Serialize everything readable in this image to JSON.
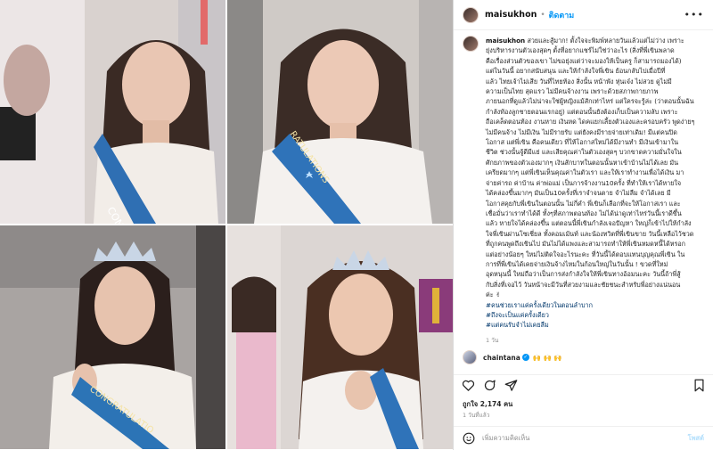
{
  "header": {
    "username": "maisukhon",
    "separator": "•",
    "follow_label": "ติดตาม",
    "more_icon": "more-horizontal-icon"
  },
  "caption": {
    "username": "maisukhon",
    "lines": [
      "สวยและสู้มาก! ตั้งใจจะพิมพ์หลายวันแล้วแต่ไม่ว่าง เพราะ",
      "ยุ่งบริหารงานตัวเองสุดๆ ตั้งที่อยากแชร์ไม่ใช่ว่าอะไร (สิ่งที่พี่เขินพลาด",
      "คือเรื่องส่วนตัวของเขา ไม่ขอยุ่งแต่ว่าจะมองให้เป็นครู ก็สามารถมองได้)",
      "แต่ในวันนี้ อยากสนับสนุน และให้กำลังใจพี่เขิน ย้อนกลับไปเมื่อปีที่",
      "แล้ว ไทยเจ้าไม่เสีย วันที่ไทยท้อง สิ่งนั้น หน้าพัง หุ่นเจ๋ง ไม่สวย ดูไม่มี",
      "ความเป็นไทย สุดแรว ไม่มีคนจ้างงาน เพราะด้วยสภาพกายภาพ",
      "ภายนอกที่ดูแล้วไม่น่าจะใช่ผู้หญิงแม้สักเท่าไหร่ แต่ใครจะรู้ล่ะ (ว่าตอนนั้นฉัน",
      "กำลังท้องลูกชายตอนแรกอยู่) แต่ตอนนั้นยังต้องเก็บเป็นความลับ เพราะ",
      "ถือเคล็ดตอนท้อง งานหาย เงินหด ไดคแยกเลี้ยงตัวเองและครอบครัว พูดง่ายๆ",
      "ไม่มีคนจ้าง ไม่มีเงิน ไม่มีรายรับ แต่ยังคงมีรายจ่ายเท่าเดิม! มีแต่คนปิด",
      "โอกาส แต่พี่เขิน คือคนเดียว ที่ให้โอกาสใหม่ได้มีงานทำ มีเงินเข้ามาใน",
      "ชีวิต ช่วงนั้นจู้ดีมีแย่ และเสียคุณค่าในตัวเองสุดๆ บวกขาดความมั่นใจใน",
      "ศักยภาพของตัวเองมากๆ เงินสักบาทในตอนนั้นหาเข้าบ้านไม่ได้เลย มัน",
      "เครียดมากๆ แต่พี่เขินเห็นคุณค่าในตัวเรา และให้เราทำงานเพื่อได้เงิน มา",
      "จ่ายค่ารถ ค่าบ้าน ค่าพ่อแม่ เป็นการจ้างงาน10ครั้ง ที่ทำให้เราได้หายใจ",
      "ได้คล่องขึ้นมากๆ มันเป็น10ครั้งที่เราจำจนตาย จำไม่ลืม จำได้เลย มี",
      "โอกาสคุยกับพี่เขินในตอนนั้น ไม่กี่คำ พี่เขินก็เลือกที่จะให้โอกาสเรา และ",
      "เชื่อมั่นว่าเราทำได้ดี ทั้งๆที่สภาพตอนท้อง ไม่ได้น่าดูเท่าไหร่วันนี้เราดีขึ้น",
      "แล้ว หายใจได้คล่องขึ้น แต่ตอนนี้พี่เขินกำลังเจอปัญหา ใหญ่ก็เข้าไปให้กำลัง",
      "ใจพี่เขินผ่านโซเชี่ยล ทั้งคอมเม้นท์ และน้องทวิตที่พี่เขินขาย วันนี้เหลือไว้ชวด",
      "ที่ถูกคนพูดถึงเขินไป มันไม่ได้แพงและสามารถทำให้พี่เขินหมดหนี้ได้หรอก",
      "แต่อย่างน้อยๆ ใหม่ไม่ติดใจอะไรนะคะ ที่วันนี้ได้ตอบแทนบุญคุณพี่เขิน ใน",
      "การที่พี่เขินได้เคยจ่ายเงินจ้างไหมในก้อนใหญ่ในวันนั้น ! ขวดที่ใหม่",
      "อุดหนุนนี้ ใหม่ถือว่าเป็นการส่งกำลังใจให้พี่เขินทางอ้อมนะคะ วันนี้ถ้าพี่สู้",
      "กับสิ่งที่เจอไว้ วันหน้าจะมีวันที่สวยงามและชัยชนะสำหรับพี่อย่างแน่นอน",
      "ค่ะ ✌"
    ],
    "hashtags": [
      "#คนช่วยเราแค่ครั้งเดียวในตอนลำบาก",
      "#ถึงจะเป็นแค่ครั้งเดียว",
      "#แต่คนรับจำไม่เคยลืม"
    ],
    "time": "1 วัน"
  },
  "comment": {
    "username": "chaintana",
    "text": "🙌 🙌 🙌"
  },
  "actions": {
    "like": "heart-icon",
    "comment": "comment-icon",
    "share": "share-icon",
    "save": "bookmark-icon"
  },
  "likes_label": "ถูกใจ 2,174 คน",
  "date_label": "1 วันที่แล้ว",
  "add_comment": {
    "emoji_icon": "emoji-icon",
    "placeholder": "เพิ่มความคิดเห็น",
    "post_label": "โพสต์"
  },
  "media": {
    "tiles": [
      {
        "sash_text": "CONG"
      },
      {
        "sash_text": "RATULATIONS"
      },
      {
        "sash_text": "CONGRATULATIO"
      },
      {
        "sash_text": ""
      }
    ]
  }
}
